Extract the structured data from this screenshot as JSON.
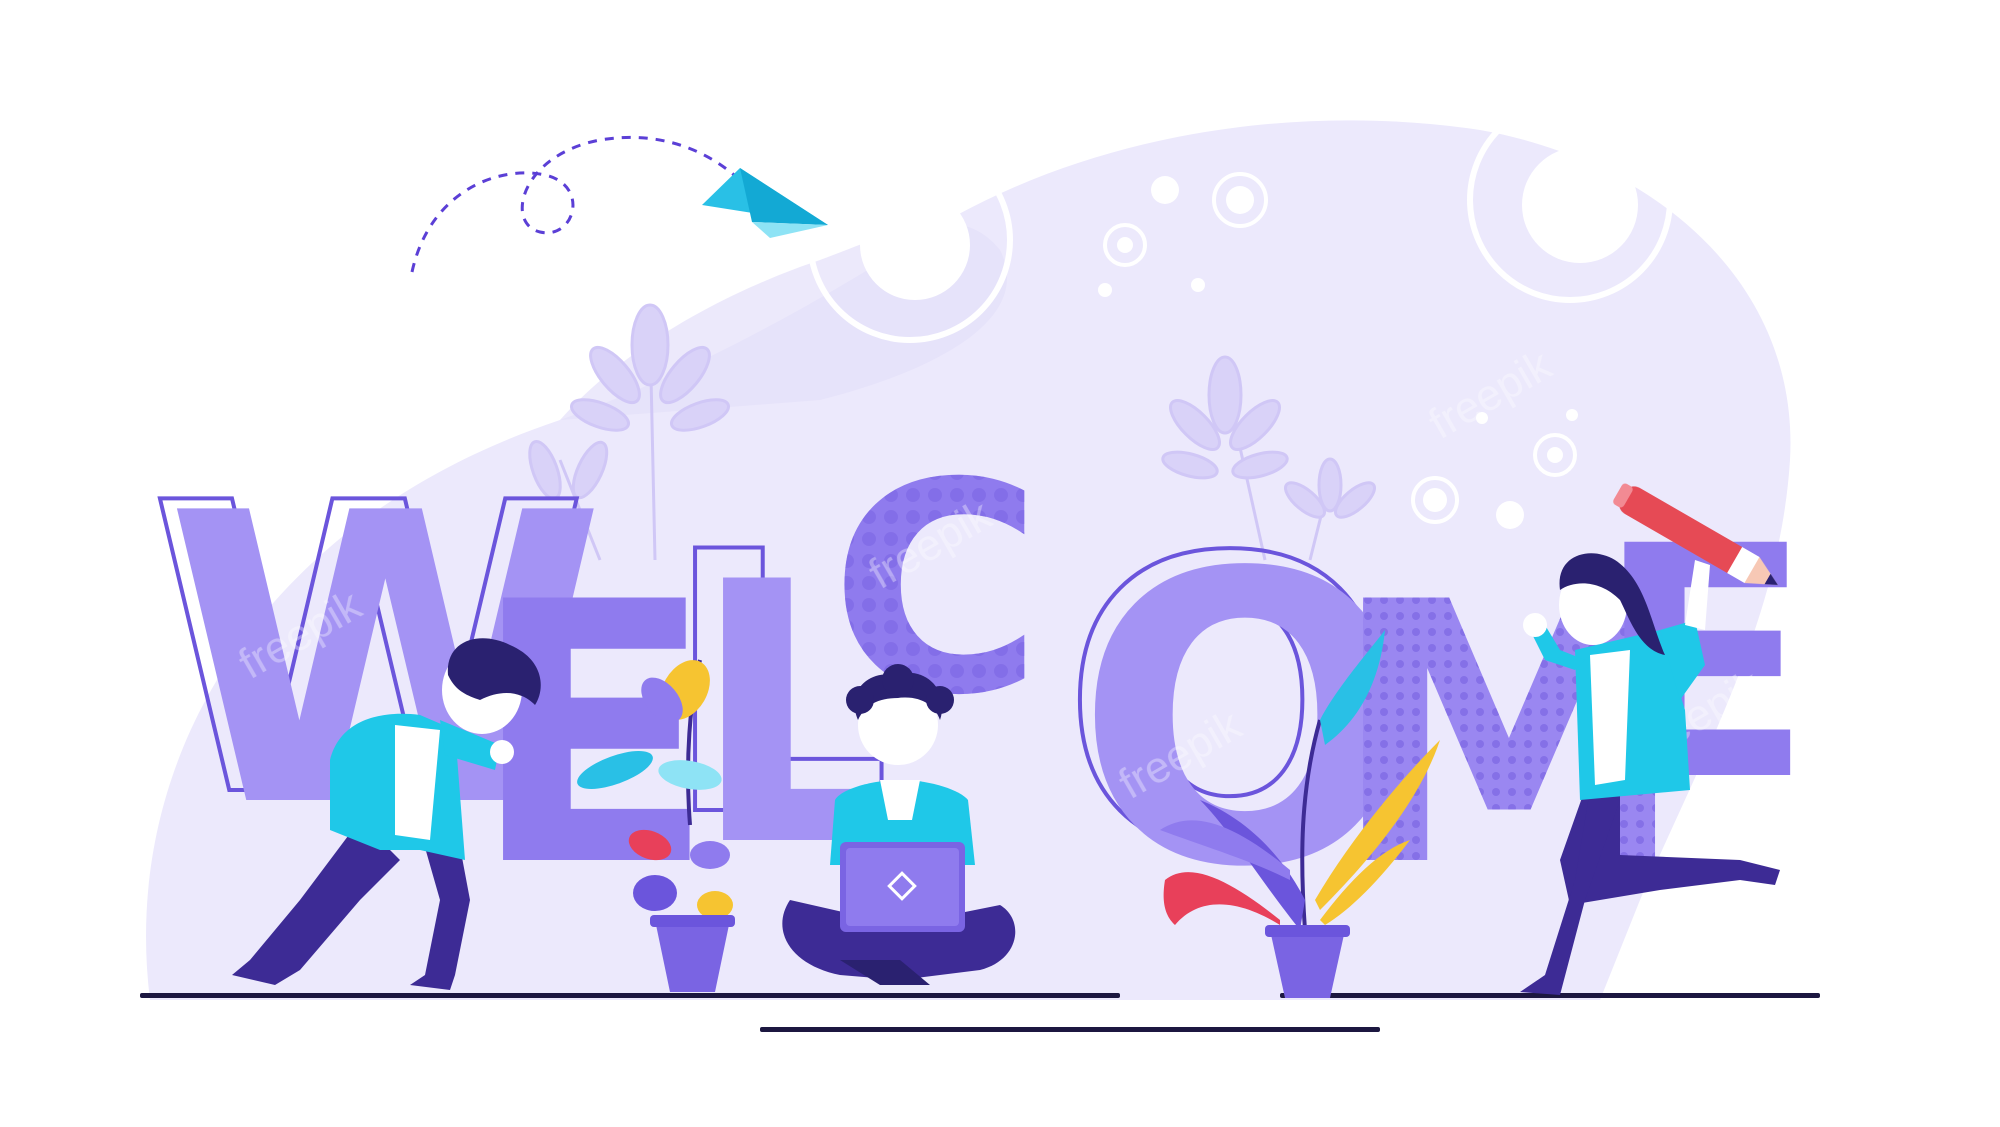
{
  "headline": {
    "letters": [
      "W",
      "E",
      "L",
      "C",
      "O",
      "M",
      "E"
    ]
  },
  "watermark": {
    "text": "freepik"
  },
  "colors": {
    "background": "#ffffff",
    "blob": "#e7e3fb",
    "letter_light": "#a493f4",
    "letter_mid": "#8f7bee",
    "letter_dark": "#7a64e3",
    "outline": "#6b55dc",
    "shirt": "#1fc8e8",
    "pants": "#3d2b95",
    "hair": "#2a2170",
    "skin": "#ffffff",
    "leaf_yellow": "#f6c431",
    "leaf_red": "#e8405a",
    "pencil": "#e64a55",
    "plane": "#29c0e6",
    "ground": "#1c1740"
  },
  "icons": [
    "paper-plane-icon",
    "pencil-icon",
    "laptop-icon",
    "plant-pot-icon"
  ]
}
